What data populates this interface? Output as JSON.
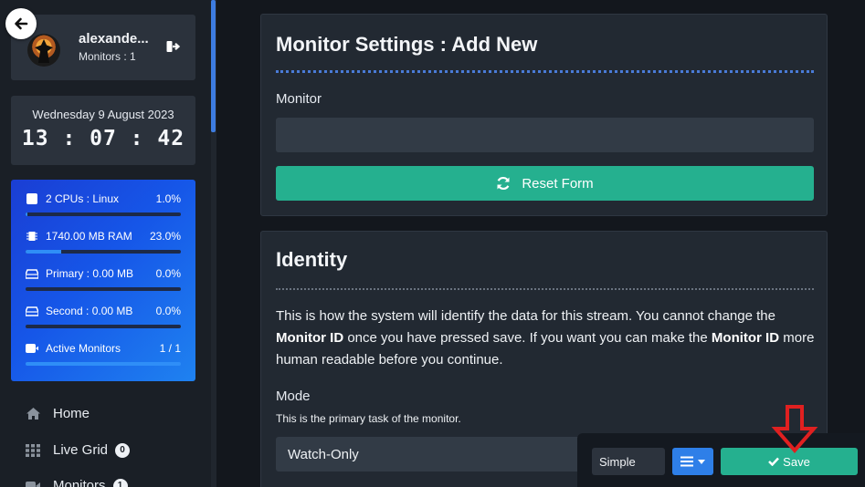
{
  "user": {
    "name": "alexande...",
    "monitors_text": "Monitors : 1"
  },
  "clock": {
    "date": "Wednesday 9 August 2023",
    "time": "13 : 07 : 42"
  },
  "stats": [
    {
      "label": "2 CPUs : Linux",
      "value": "1.0%",
      "fill": 0.01,
      "icon": "square-icon"
    },
    {
      "label": "1740.00 MB RAM",
      "value": "23.0%",
      "fill": 0.23,
      "icon": "memory-chip-icon"
    },
    {
      "label": "Primary : 0.00 MB",
      "value": "0.0%",
      "fill": 0.0,
      "icon": "hard-drive-icon"
    },
    {
      "label": "Second : 0.00 MB",
      "value": "0.0%",
      "fill": 0.0,
      "icon": "hard-drive-icon"
    },
    {
      "label": "Active Monitors",
      "value": "1 / 1",
      "fill": 1.0,
      "icon": "video-camera-icon"
    }
  ],
  "nav": [
    {
      "label": "Home",
      "icon": "home-icon",
      "badge": ""
    },
    {
      "label": "Live Grid",
      "icon": "grid-icon",
      "badge": "0"
    },
    {
      "label": "Monitors",
      "icon": "video-camera-icon",
      "badge": "1"
    }
  ],
  "settings_card": {
    "title": "Monitor Settings : Add New",
    "monitor_label": "Monitor",
    "monitor_value": "",
    "reset_label": "Reset Form"
  },
  "identity_card": {
    "title": "Identity",
    "para_1": "This is how the system will identify the data for this stream. You cannot change the",
    "para_bold_1": "Monitor ID",
    "para_2": " once you have pressed save. If you want you can make the ",
    "para_bold_2": "Monitor ID",
    "para_3": "more human readable before you continue.",
    "mode_label": "Mode",
    "mode_help": "This is the primary task of the monitor.",
    "mode_value": "Watch-Only"
  },
  "toolbar": {
    "simple_label": "Simple",
    "save_label": "Save"
  },
  "colors": {
    "accent_green": "#25b08f",
    "accent_blue": "#2e7fe8",
    "annotation_red": "#e02020"
  }
}
